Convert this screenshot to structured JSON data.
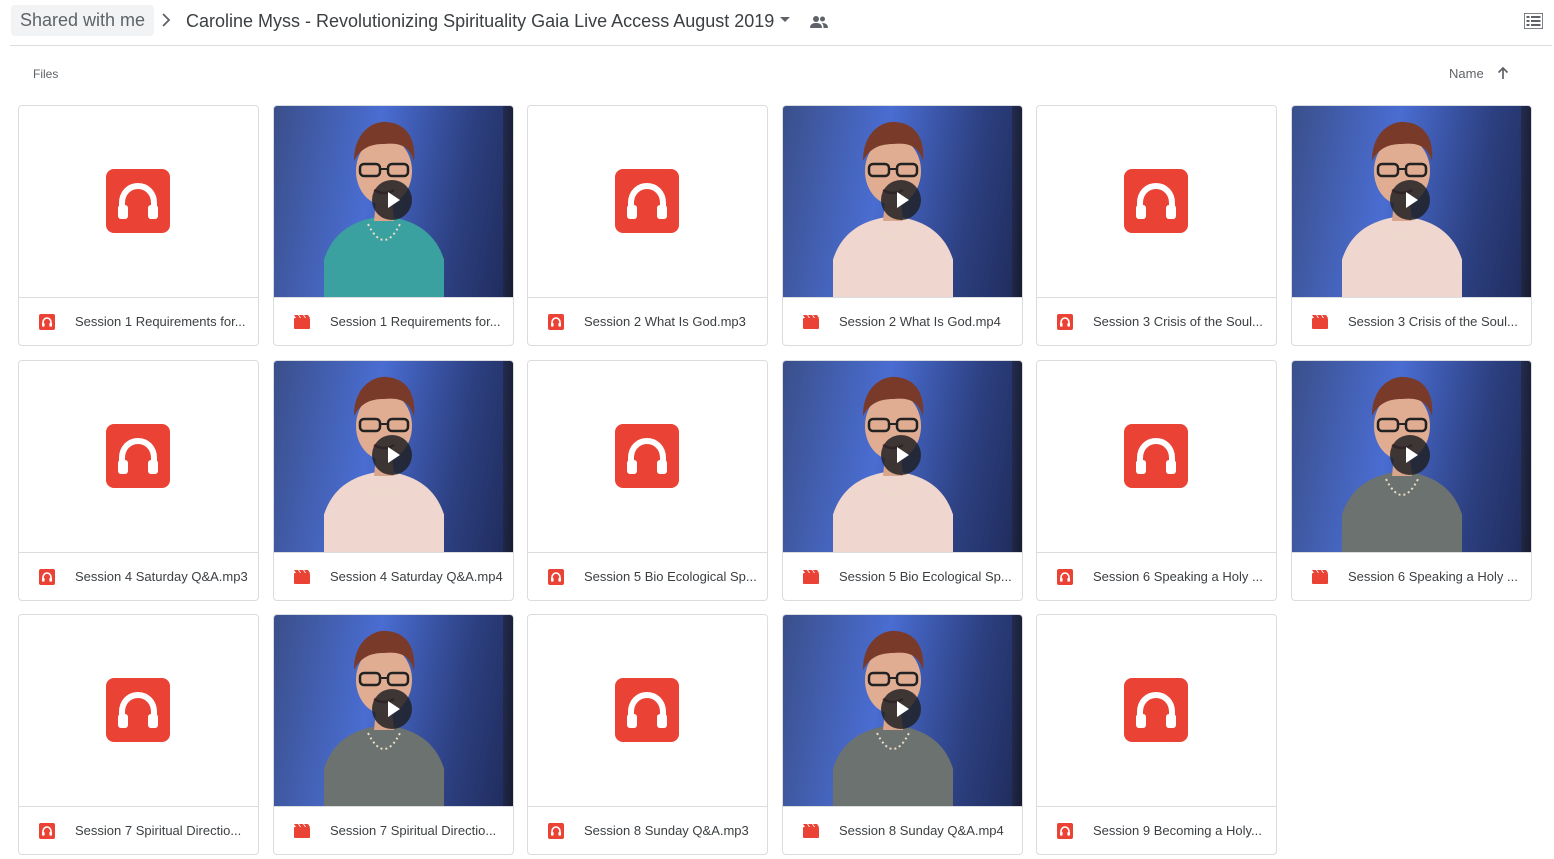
{
  "breadcrumb": {
    "root": "Shared with me",
    "folder": "Caroline Myss - Revolutionizing Spirituality Gaia Live Access August 2019"
  },
  "section": {
    "label": "Files"
  },
  "sort": {
    "label": "Name",
    "direction": "ascending"
  },
  "colors": {
    "audio": "#ea4335",
    "video": "#ea4335",
    "video_sky": "#4a6dd2"
  },
  "files": [
    {
      "name": "Session 1 Requirements for...",
      "type": "audio"
    },
    {
      "name": "Session 1 Requirements for...",
      "type": "video",
      "outfit": "teal"
    },
    {
      "name": "Session 2 What Is God.mp3",
      "type": "audio"
    },
    {
      "name": "Session 2 What Is God.mp4",
      "type": "video",
      "outfit": "pink"
    },
    {
      "name": "Session 3 Crisis of the Soul...",
      "type": "audio"
    },
    {
      "name": "Session 3 Crisis of the Soul...",
      "type": "video",
      "outfit": "pink"
    },
    {
      "name": "Session 4 Saturday Q&A.mp3",
      "type": "audio"
    },
    {
      "name": "Session 4 Saturday Q&A.mp4",
      "type": "video",
      "outfit": "pink"
    },
    {
      "name": "Session 5 Bio Ecological Sp...",
      "type": "audio"
    },
    {
      "name": "Session 5 Bio Ecological Sp...",
      "type": "video",
      "outfit": "pink"
    },
    {
      "name": "Session 6 Speaking a Holy ...",
      "type": "audio"
    },
    {
      "name": "Session 6 Speaking a Holy ...",
      "type": "video",
      "outfit": "gray"
    },
    {
      "name": "Session 7 Spiritual Directio...",
      "type": "audio"
    },
    {
      "name": "Session 7 Spiritual Directio...",
      "type": "video",
      "outfit": "gray"
    },
    {
      "name": "Session 8 Sunday Q&A.mp3",
      "type": "audio"
    },
    {
      "name": "Session 8 Sunday Q&A.mp4",
      "type": "video",
      "outfit": "gray"
    },
    {
      "name": "Session 9 Becoming a Holy...",
      "type": "audio"
    }
  ]
}
